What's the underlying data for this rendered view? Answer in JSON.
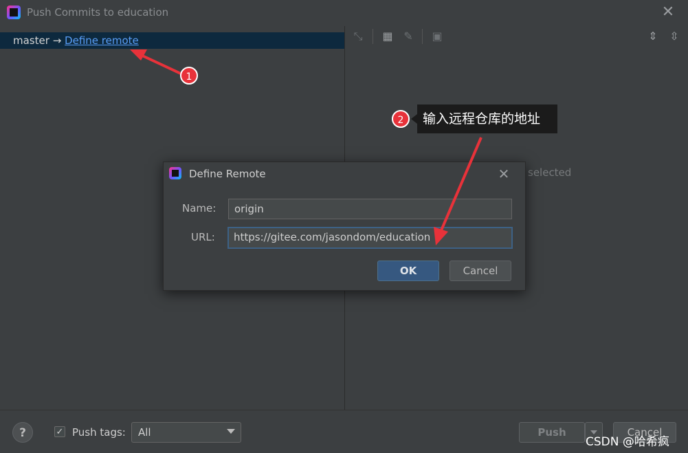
{
  "window": {
    "title": "Push Commits to education"
  },
  "branch": {
    "local": "master",
    "arrow": "→",
    "link": "Define remote"
  },
  "right_pane": {
    "empty_text": "selected"
  },
  "dialog": {
    "title": "Define Remote",
    "name_label": "Name:",
    "name_value": "origin",
    "url_label": "URL:",
    "url_value": "https://gitee.com/jasondom/education",
    "ok_label": "OK",
    "cancel_label": "Cancel"
  },
  "bottom": {
    "help_label": "?",
    "pushtags_label": "Push tags:",
    "pushtags_checked": true,
    "select_value": "All",
    "push_label": "Push",
    "cancel_label": "Cancel"
  },
  "annotations": {
    "badge1": "1",
    "badge2": "2",
    "callout_text": "输入远程仓库的地址",
    "arrow_color": "#e8323a"
  },
  "watermark": "CSDN @哈希疯",
  "colors": {
    "accent": "#365880",
    "link": "#589df6",
    "selection": "#0d293e",
    "background": "#3c3f41"
  }
}
